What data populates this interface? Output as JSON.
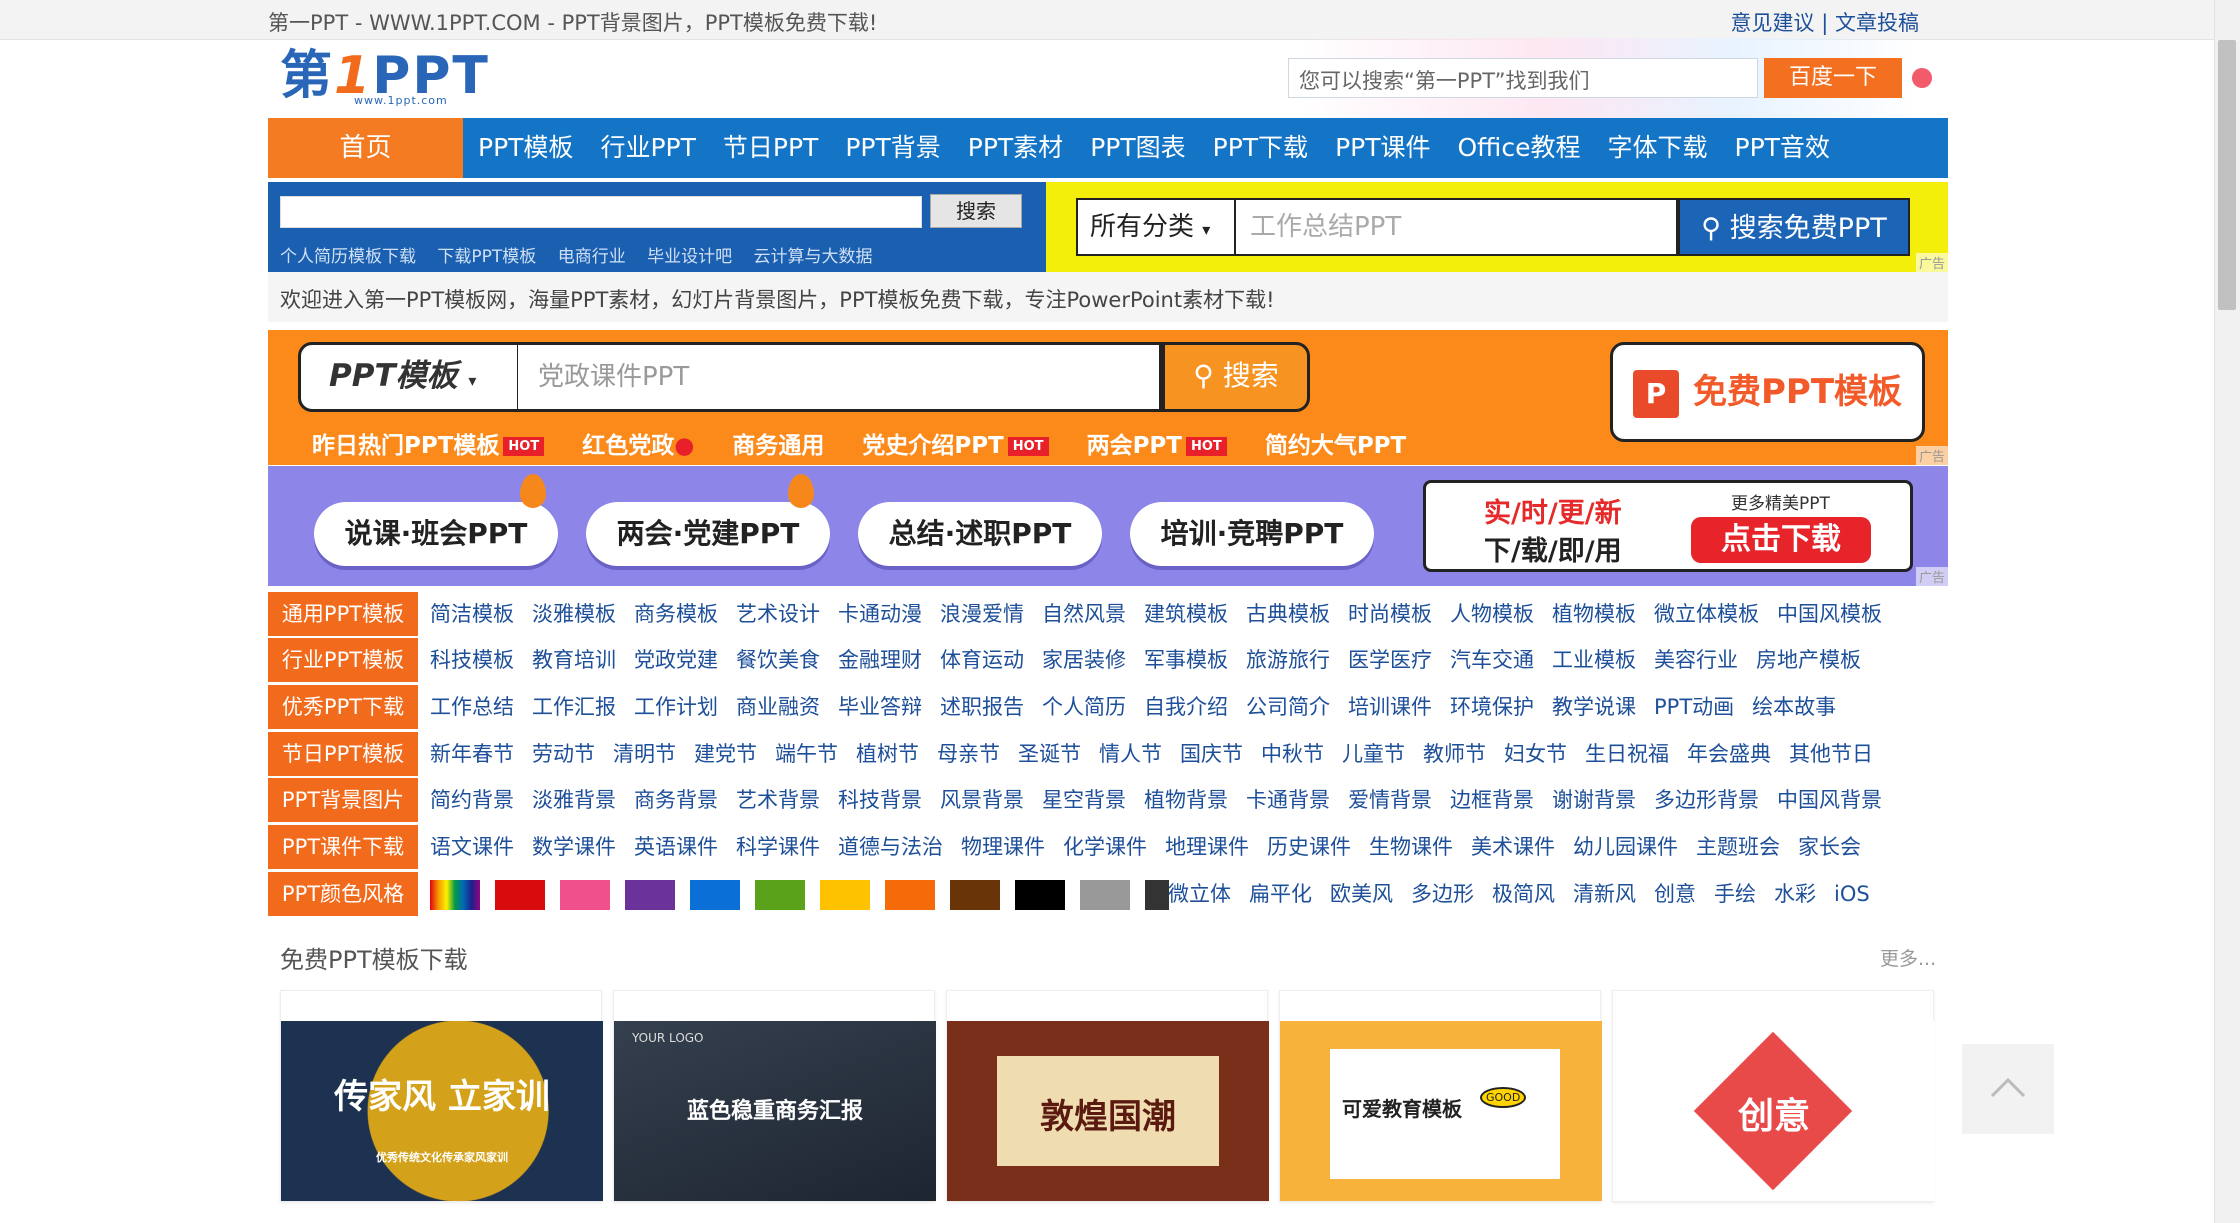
{
  "topbar": {
    "title": "第一PPT - WWW.1PPT.COM - PPT背景图片，PPT模板免费下载!",
    "feedback": "意见建议",
    "separator": "|",
    "submit": "文章投稿"
  },
  "logo": {
    "text_a": "第",
    "text_b": "1",
    "text_c": "PPT",
    "url": "www.1ppt.com"
  },
  "baidu": {
    "placeholder": "您可以搜索“第一PPT”找到我们",
    "button": "百度一下"
  },
  "nav": {
    "home": "首页",
    "items": [
      "PPT模板",
      "行业PPT",
      "节日PPT",
      "PPT背景",
      "PPT素材",
      "PPT图表",
      "PPT下载",
      "PPT课件",
      "Office教程",
      "字体下载",
      "PPT音效"
    ]
  },
  "search": {
    "button": "搜索",
    "hot": [
      "个人简历模板下载",
      "下载PPT模板",
      "电商行业",
      "毕业设计吧",
      "云计算与大数据"
    ],
    "category": "所有分类",
    "placeholder": "工作总结PPT",
    "free_button": "搜索免费PPT",
    "ad_label": "广告"
  },
  "welcome": "欢迎进入第一PPT模板网，海量PPT素材，幻灯片背景图片，PPT模板免费下载，专注PowerPoint素材下载!",
  "orange_banner": {
    "type": "PPT模板",
    "placeholder": "党政课件PPT",
    "button": "搜索",
    "free": "免费PPT模板",
    "free_icon": "P",
    "links": [
      "昨日热门PPT模板",
      "红色党政",
      "商务通用",
      "党史介绍PPT",
      "两会PPT",
      "简约大气PPT"
    ],
    "hot_badge": "HOT",
    "ad_label": "广告"
  },
  "purple_banner": {
    "pills": [
      "说课·班会PPT",
      "两会·党建PPT",
      "总结·述职PPT",
      "培训·竞聘PPT"
    ],
    "line1": "实/时/更/新",
    "line2": "下/载/即/用",
    "more": "更多精美PPT",
    "download": "点击下载",
    "ad_label": "广告"
  },
  "categories": [
    {
      "tag": "通用PPT模板",
      "links": [
        "简洁模板",
        "淡雅模板",
        "商务模板",
        "艺术设计",
        "卡通动漫",
        "浪漫爱情",
        "自然风景",
        "建筑模板",
        "古典模板",
        "时尚模板",
        "人物模板",
        "植物模板",
        "微立体模板",
        "中国风模板"
      ]
    },
    {
      "tag": "行业PPT模板",
      "links": [
        "科技模板",
        "教育培训",
        "党政党建",
        "餐饮美食",
        "金融理财",
        "体育运动",
        "家居装修",
        "军事模板",
        "旅游旅行",
        "医学医疗",
        "汽车交通",
        "工业模板",
        "美容行业",
        "房地产模板"
      ]
    },
    {
      "tag": "优秀PPT下载",
      "links": [
        "工作总结",
        "工作汇报",
        "工作计划",
        "商业融资",
        "毕业答辩",
        "述职报告",
        "个人简历",
        "自我介绍",
        "公司简介",
        "培训课件",
        "环境保护",
        "教学说课",
        "PPT动画",
        "绘本故事"
      ]
    },
    {
      "tag": "节日PPT模板",
      "links": [
        "新年春节",
        "劳动节",
        "清明节",
        "建党节",
        "端午节",
        "植树节",
        "母亲节",
        "圣诞节",
        "情人节",
        "国庆节",
        "中秋节",
        "儿童节",
        "教师节",
        "妇女节",
        "生日祝福",
        "年会盛典",
        "其他节日"
      ]
    },
    {
      "tag": "PPT背景图片",
      "links": [
        "简约背景",
        "淡雅背景",
        "商务背景",
        "艺术背景",
        "科技背景",
        "风景背景",
        "星空背景",
        "植物背景",
        "卡通背景",
        "爱情背景",
        "边框背景",
        "谢谢背景",
        "多边形背景",
        "中国风背景"
      ]
    },
    {
      "tag": "PPT课件下载",
      "links": [
        "语文课件",
        "数学课件",
        "英语课件",
        "科学课件",
        "道德与法治",
        "物理课件",
        "化学课件",
        "地理课件",
        "历史课件",
        "生物课件",
        "美术课件",
        "幼儿园课件",
        "主题班会",
        "家长会"
      ]
    }
  ],
  "colors": {
    "tag": "PPT颜色风格",
    "swatches": [
      "#d80c0c",
      "#f0508c",
      "#6b3399",
      "#0a6fd6",
      "#5aa21a",
      "#ffc200",
      "#f56b0a",
      "#6a3409",
      "#000000",
      "#999999",
      "#333333"
    ],
    "styles": [
      "微立体",
      "扁平化",
      "欧美风",
      "多边形",
      "极简风",
      "清新风",
      "创意",
      "手绘",
      "水彩",
      "iOS"
    ]
  },
  "section": {
    "title": "免费PPT模板下载",
    "more": "更多..."
  },
  "cards": [
    {
      "caption": "传家风 立家训",
      "sub": "优秀传统文化传承家风家训"
    },
    {
      "caption": "蓝色稳重商务汇报",
      "sub": "YOUR LOGO"
    },
    {
      "caption": "敦煌国潮",
      "sub": ""
    },
    {
      "caption": "可爱教育模板",
      "sub": "GOOD"
    },
    {
      "caption": "创意",
      "sub": ""
    }
  ],
  "accent": {
    "orange": "#f47b22",
    "blue": "#1475c7",
    "link": "#1e4f99"
  }
}
